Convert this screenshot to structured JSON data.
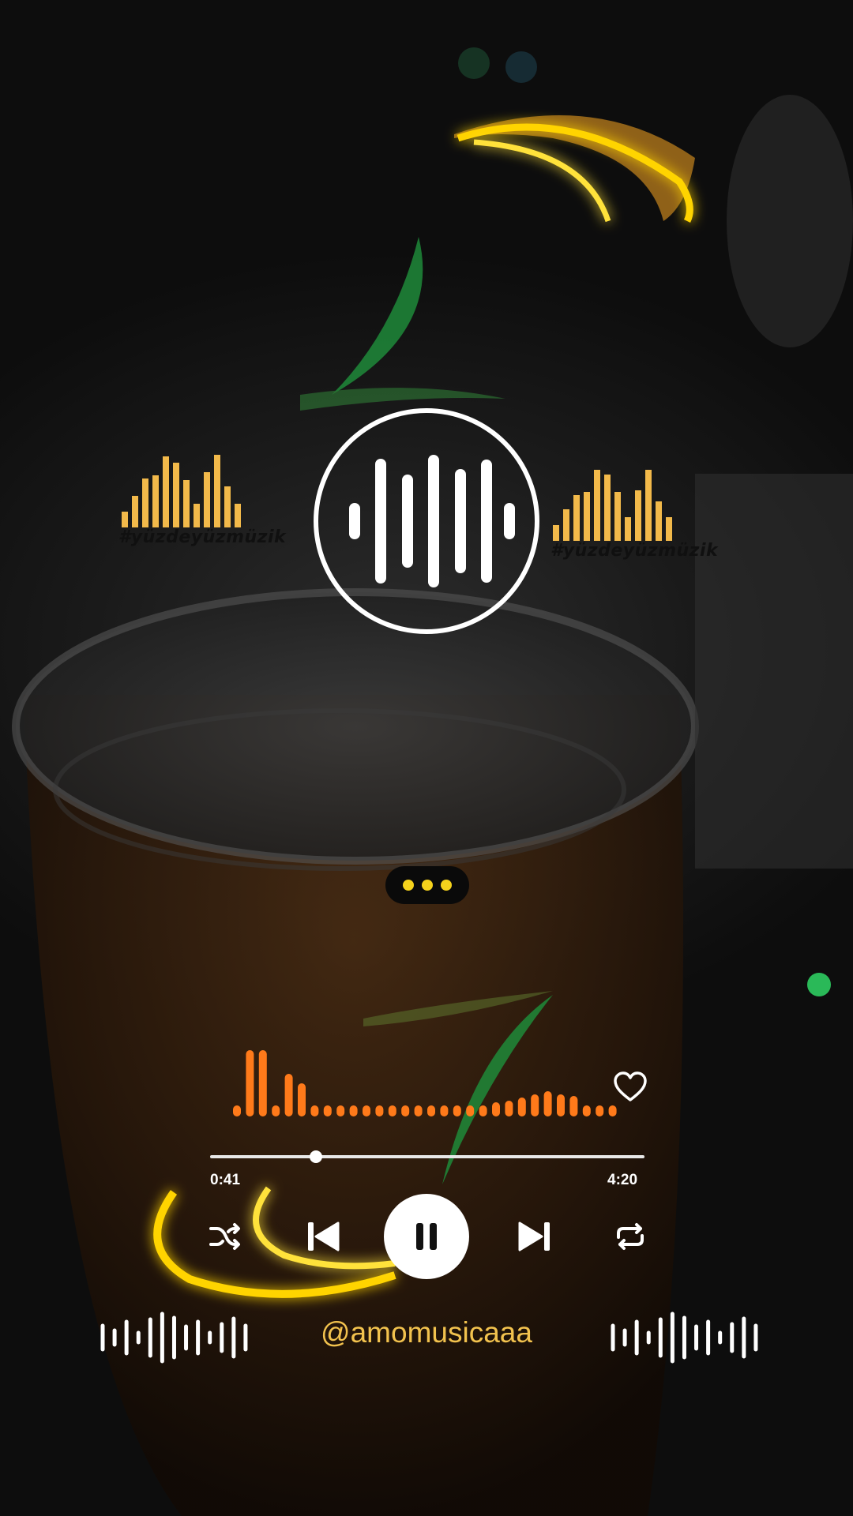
{
  "player": {
    "watermark_left": "#yüzdeyüzmüzik",
    "watermark_right": "#yüzdeyüzmüzik",
    "elapsed": "0:41",
    "duration": "4:20",
    "progress_fraction": 0.244,
    "liked": false,
    "is_playing": true,
    "handle": "@amomusicaaa"
  },
  "icons": {
    "shuffle": "shuffle-icon",
    "previous": "skip-previous-icon",
    "pause": "pause-icon",
    "next": "skip-next-icon",
    "repeat": "repeat-icon",
    "heart": "heart-outline-icon",
    "logo": "spotify-code-logo"
  },
  "colors": {
    "equalizer": "#f2b94a",
    "waveform": "#ff7a1a",
    "handle_text": "#f2c24e",
    "typing_dots": "#f5d21c"
  }
}
